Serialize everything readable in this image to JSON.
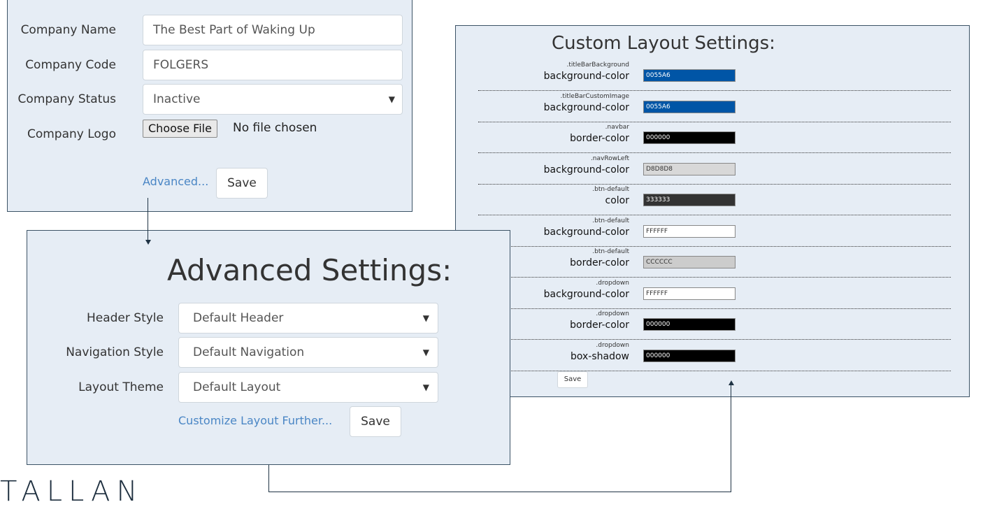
{
  "company": {
    "fields": [
      {
        "label": "Company Name",
        "value": "The Best Part of Waking Up"
      },
      {
        "label": "Company Code",
        "value": "FOLGERS"
      },
      {
        "label": "Company Status",
        "value": "Inactive"
      },
      {
        "label": "Company Logo"
      }
    ],
    "file_button": "Choose File",
    "file_status": "No file chosen",
    "advanced_link": "Advanced...",
    "save_label": "Save"
  },
  "advanced": {
    "title": "Advanced Settings:",
    "fields": [
      {
        "label": "Header Style",
        "value": "Default Header"
      },
      {
        "label": "Navigation Style",
        "value": "Default Navigation"
      },
      {
        "label": "Layout Theme",
        "value": "Default Layout"
      }
    ],
    "customize_link": "Customize Layout Further...",
    "save_label": "Save"
  },
  "custom": {
    "title": "Custom Layout Settings:",
    "rows": [
      {
        "selector": ".titleBarBackground",
        "property": "background-color",
        "value": "0055A6",
        "color": "#0055A6",
        "text_color": "#ffffff"
      },
      {
        "selector": ".titleBarCustomImage",
        "property": "background-color",
        "value": "0055A6",
        "color": "#0055A6",
        "text_color": "#ffffff"
      },
      {
        "selector": ".navbar",
        "property": "border-color",
        "value": "000000",
        "color": "#000000",
        "text_color": "#ffffff"
      },
      {
        "selector": ".navRowLeft",
        "property": "background-color",
        "value": "D8D8D8",
        "color": "#D8D8D8",
        "text_color": "#333333"
      },
      {
        "selector": ".btn-default",
        "property": "color",
        "value": "333333",
        "color": "#333333",
        "text_color": "#ffffff"
      },
      {
        "selector": ".btn-default",
        "property": "background-color",
        "value": "FFFFFF",
        "color": "#FFFFFF",
        "text_color": "#333333"
      },
      {
        "selector": ".btn-default",
        "property": "border-color",
        "value": "CCCCCC",
        "color": "#CCCCCC",
        "text_color": "#333333"
      },
      {
        "selector": ".dropdown",
        "property": "background-color",
        "value": "FFFFFF",
        "color": "#FFFFFF",
        "text_color": "#333333"
      },
      {
        "selector": ".dropdown",
        "property": "border-color",
        "value": "000000",
        "color": "#000000",
        "text_color": "#ffffff"
      },
      {
        "selector": ".dropdown",
        "property": "box-shadow",
        "value": "000000",
        "color": "#000000",
        "text_color": "#ffffff"
      }
    ],
    "save_label": "Save"
  },
  "branding": {
    "logo_text": "TALLAN"
  },
  "colors": {
    "panel_bg": "#e6edf5",
    "panel_border": "#3c5366",
    "link": "#4a86c5"
  }
}
